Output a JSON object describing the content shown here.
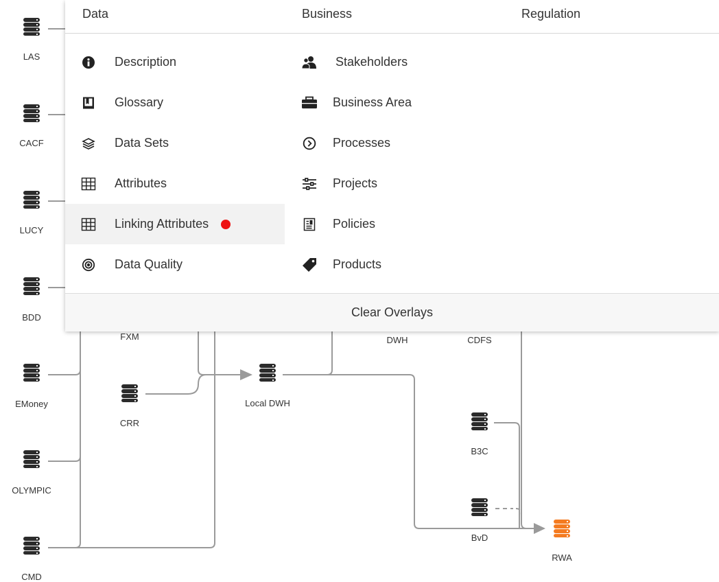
{
  "menu": {
    "columns": [
      "Data",
      "Business",
      "Regulation"
    ],
    "data_items": [
      {
        "label": "Description",
        "icon": "info-circle-icon"
      },
      {
        "label": "Glossary",
        "icon": "book-icon"
      },
      {
        "label": "Data Sets",
        "icon": "layers-icon"
      },
      {
        "label": "Attributes",
        "icon": "grid-icon"
      },
      {
        "label": "Linking Attributes",
        "icon": "grid-icon",
        "selected": true
      },
      {
        "label": "Data Quality",
        "icon": "target-icon"
      }
    ],
    "business_items": [
      {
        "label": "Stakeholders",
        "icon": "people-icon"
      },
      {
        "label": "Business Area",
        "icon": "briefcase-icon"
      },
      {
        "label": "Processes",
        "icon": "chevron-circle-icon"
      },
      {
        "label": "Projects",
        "icon": "sliders-icon"
      },
      {
        "label": "Policies",
        "icon": "document-icon"
      },
      {
        "label": "Products",
        "icon": "tag-icon"
      }
    ],
    "clear_label": "Clear Overlays",
    "selected_indicator_color": "#ee1111"
  },
  "graph": {
    "nodes": [
      {
        "label": "LAS"
      },
      {
        "label": "CACF"
      },
      {
        "label": "LUCY"
      },
      {
        "label": "BDD"
      },
      {
        "label": "EMoney"
      },
      {
        "label": "OLYMPIC"
      },
      {
        "label": "CMD"
      },
      {
        "label": "FXM"
      },
      {
        "label": "CRR"
      },
      {
        "label": "Local DWH"
      },
      {
        "label": "DWH"
      },
      {
        "label": "CDFS"
      },
      {
        "label": "B3C"
      },
      {
        "label": "BvD"
      },
      {
        "label": "RWA",
        "highlight": true
      }
    ],
    "edge_color": "#9a9a9a",
    "highlight_color": "#f47b20"
  }
}
